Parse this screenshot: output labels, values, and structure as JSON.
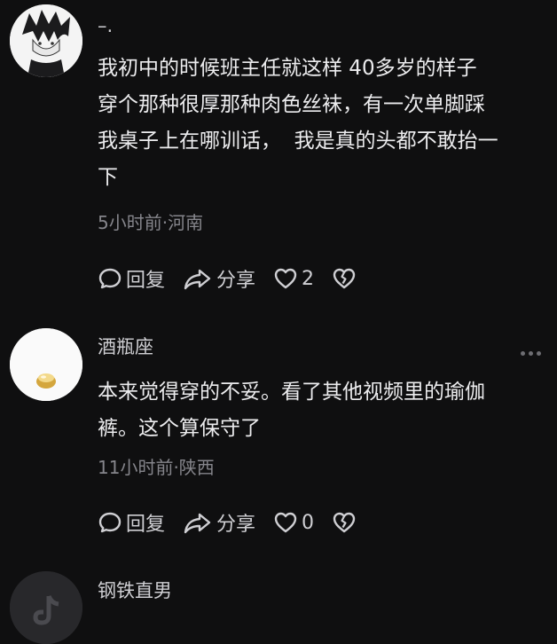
{
  "comments": [
    {
      "username": "–.",
      "text": "我初中的时候班主任就这样 40多岁的样子\n穿个那种很厚那种肉色丝袜，有一次单脚踩\n我桌子上在哪训话，  我是真的头都不敢抬一\n下",
      "meta": "5小时前·河南",
      "reply_label": "回复",
      "share_label": "分享",
      "like_count": "2"
    },
    {
      "username": "酒瓶座",
      "text": "本来觉得穿的不妥。看了其他视频里的瑜伽\n裤。这个算保守了",
      "meta": "11小时前·陕西",
      "reply_label": "回复",
      "share_label": "分享",
      "like_count": "0"
    },
    {
      "username": "钢铁直男"
    }
  ],
  "colors": {
    "background": "#0f0f10",
    "text": "#ececee",
    "meta": "#85858b"
  }
}
